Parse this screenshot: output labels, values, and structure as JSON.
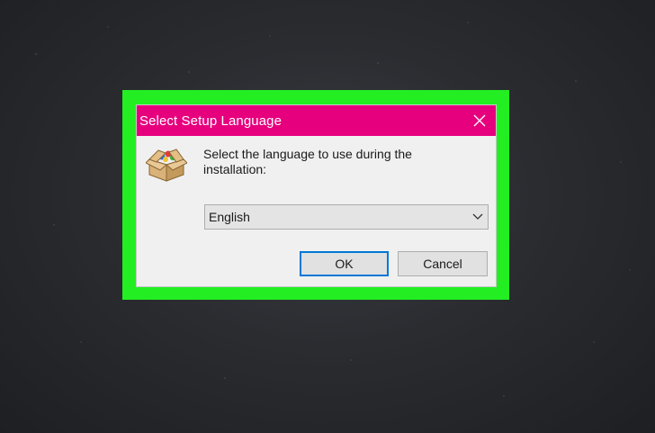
{
  "dialog": {
    "title": "Select Setup Language",
    "prompt": "Select the language to use during the installation:",
    "language_select": {
      "selected": "English"
    },
    "ok_label": "OK",
    "cancel_label": "Cancel"
  },
  "icons": {
    "close": "close-icon",
    "setup": "setup-box-icon",
    "dropdown": "chevron-down-icon"
  },
  "colors": {
    "titlebar": "#e6007e",
    "highlight_frame": "#22ee22",
    "default_button_border": "#0078d7"
  }
}
